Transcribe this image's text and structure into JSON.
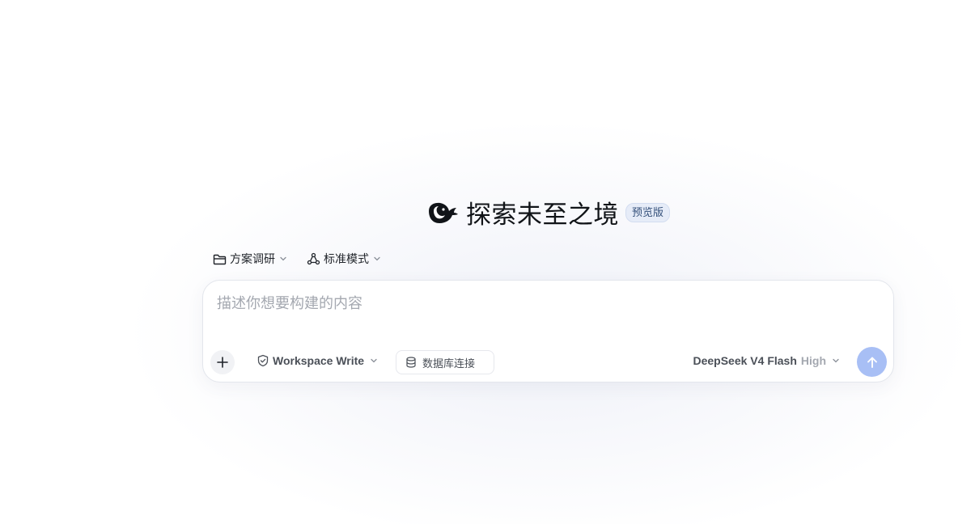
{
  "hero": {
    "logo_icon": "deepseek-whale-icon",
    "title": "探索未至之境",
    "badge": "预览版"
  },
  "selectors": {
    "project": {
      "label": "方案调研",
      "icon": "folder-icon"
    },
    "mode": {
      "label": "标准模式",
      "icon": "agents-network-icon"
    }
  },
  "composer": {
    "placeholder": "描述你想要构建的内容",
    "value": "",
    "add_icon": "plus-icon",
    "permission": {
      "label": "Workspace Write",
      "icon": "shield-check-icon"
    },
    "database": {
      "label": "数据库连接",
      "icon": "database-icon"
    },
    "model": {
      "name": "DeepSeek V4 Flash",
      "effort": "High"
    },
    "send_icon": "arrow-up-icon"
  },
  "colors": {
    "send_button": "#a8bff5",
    "badge_bg": "#e6ecf8",
    "badge_text": "#34507a",
    "placeholder": "#a4a8b0"
  }
}
